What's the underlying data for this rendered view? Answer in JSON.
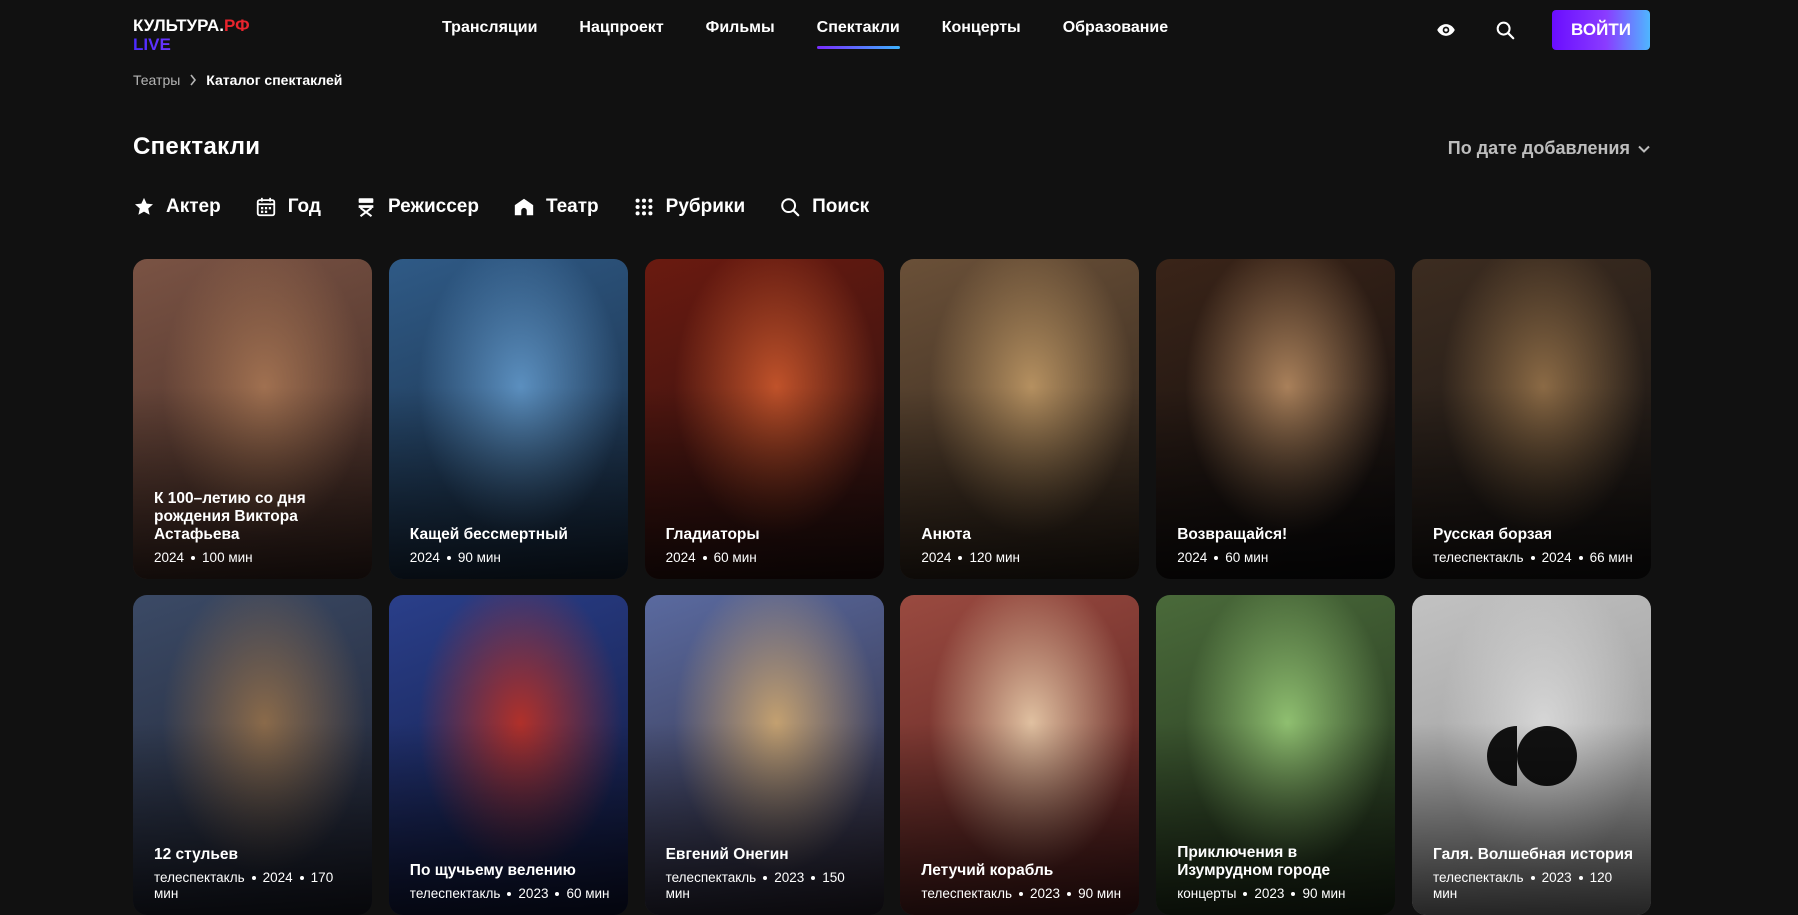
{
  "header": {
    "logo_line1": "КУЛЬТУРА.",
    "logo_line1_accent": "РФ",
    "logo_line2": "LIVE",
    "nav": [
      "Трансляции",
      "Нацпроект",
      "Фильмы",
      "Спектакли",
      "Концерты",
      "Образование"
    ],
    "active_nav": "Спектакли",
    "login_label": "ВОЙТИ",
    "icons": [
      "eye-icon",
      "search-icon"
    ]
  },
  "breadcrumb": {
    "parent": "Театры",
    "current": "Каталог спектаклей"
  },
  "page": {
    "title": "Спектакли",
    "sort_label": "По дате добавления"
  },
  "filters": [
    {
      "label": "Актер",
      "icon": "star-icon"
    },
    {
      "label": "Год",
      "icon": "calendar-icon"
    },
    {
      "label": "Режиссер",
      "icon": "director-chair-icon"
    },
    {
      "label": "Театр",
      "icon": "theater-icon"
    },
    {
      "label": "Рубрики",
      "icon": "grid-dots-icon"
    },
    {
      "label": "Поиск",
      "icon": "search-icon"
    }
  ],
  "cards": [
    {
      "title": "К 100–летию со дня рождения Виктора Астафьева",
      "meta": [
        "2024",
        "100 мин"
      ],
      "bg": [
        "#7a5344",
        "#3a2520",
        "#a07050"
      ]
    },
    {
      "title": "Кащей бессмертный",
      "meta": [
        "2024",
        "90 мин"
      ],
      "bg": [
        "#2f5a86",
        "#16263a",
        "#5b8fbf"
      ]
    },
    {
      "title": "Гладиаторы",
      "meta": [
        "2024",
        "60 мин"
      ],
      "bg": [
        "#6a1a10",
        "#241010",
        "#c0522a"
      ]
    },
    {
      "title": "Анюта",
      "meta": [
        "2024",
        "120 мин"
      ],
      "bg": [
        "#6a5038",
        "#2a2018",
        "#b59060"
      ]
    },
    {
      "title": "Возвращайся!",
      "meta": [
        "2024",
        "60 мин"
      ],
      "bg": [
        "#3a2418",
        "#0b0b0d",
        "#a9805a"
      ]
    },
    {
      "title": "Русская борзая",
      "meta": [
        "телеспектакль",
        "2024",
        "66 мин"
      ],
      "bg": [
        "#3c2c20",
        "#141212",
        "#8b6a45"
      ]
    },
    {
      "title": "12 стульев",
      "meta": [
        "телеспектакль",
        "2024",
        "170 мин"
      ],
      "bg": [
        "#3b4a66",
        "#1c1e2a",
        "#8a6a4a"
      ]
    },
    {
      "title": "По щучьему велению",
      "meta": [
        "телеспектакль",
        "2023",
        "60 мин"
      ],
      "bg": [
        "#2a3f8a",
        "#0e1436",
        "#b0302a"
      ]
    },
    {
      "title": "Евгений Онегин",
      "meta": [
        "телеспектакль",
        "2023",
        "150 мин"
      ],
      "bg": [
        "#5a6aa0",
        "#2a2430",
        "#c3a070"
      ]
    },
    {
      "title": "Летучий корабль",
      "meta": [
        "телеспектакль",
        "2023",
        "90 мин"
      ],
      "bg": [
        "#9a4a40",
        "#4a1a1a",
        "#e0c0a0"
      ]
    },
    {
      "title": "Приключения в Изумрудном городе",
      "meta": [
        "концерты",
        "2023",
        "90 мин"
      ],
      "bg": [
        "#4a6a3a",
        "#1c2a18",
        "#8fbf70"
      ]
    },
    {
      "title": "Галя. Волшебная история",
      "meta": [
        "телеспектакль",
        "2023",
        "120 мин"
      ],
      "bg": [
        "#c2c2c2",
        "#8c8c8c",
        "#d6d6d6"
      ],
      "placeholder_logo": true
    }
  ]
}
